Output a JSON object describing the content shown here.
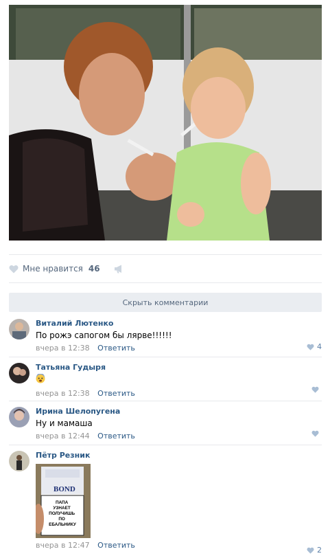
{
  "post": {
    "likes": {
      "label": "Мне нравится",
      "count": "46",
      "icon": "heart-icon",
      "share_icon": "megaphone-icon"
    }
  },
  "comments_section": {
    "hide_label": "Скрыть комментарии",
    "reply_label": "Ответить",
    "items": [
      {
        "author": "Виталий Лютенко",
        "text": "По рожэ сапогом бы лярве!!!!!!",
        "time": "вчера в 12:38",
        "likes": "4"
      },
      {
        "author": "Татьяна Гудыря",
        "text": "",
        "emoji": "fearful-face-emoji",
        "time": "вчера в 12:38",
        "likes": ""
      },
      {
        "author": "Ирина Шелопугена",
        "text": "Ну и мамаша",
        "time": "вчера в 12:44",
        "likes": ""
      },
      {
        "author": "Пётр Резник",
        "text": "",
        "time": "вчера в 12:47",
        "likes": "2",
        "image_text": {
          "brand": "BOND",
          "warning": "ПАПА УЗНАЕТ ПОЛУЧИШЬ ПО ЕБАЛЬНИКУ"
        }
      }
    ]
  },
  "colors": {
    "link": "#2a5885",
    "muted": "#939393",
    "button_bg": "#eaedf1",
    "divider": "#e7e8ec"
  }
}
